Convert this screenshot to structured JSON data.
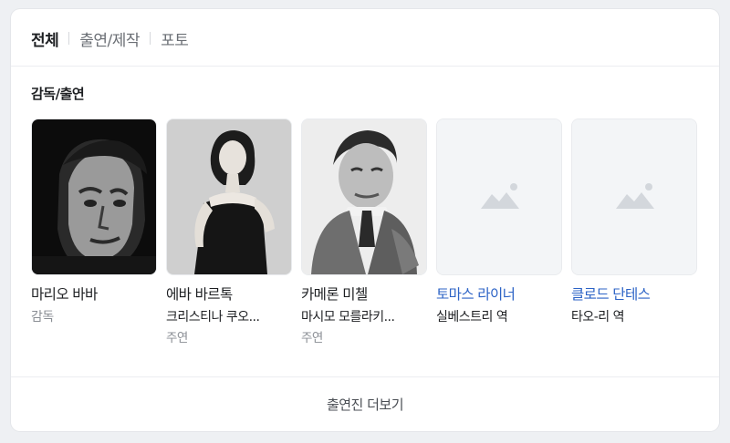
{
  "tabs": [
    {
      "label": "전체",
      "active": true
    },
    {
      "label": "출연/제작",
      "active": false
    },
    {
      "label": "포토",
      "active": false
    }
  ],
  "section_title": "감독/출연",
  "people": [
    {
      "name": "마리오 바바",
      "role": "감독",
      "sub": "",
      "photo": "portrait-photo"
    },
    {
      "name": "에바 바르톡",
      "role": "크리스티나 쿠오...",
      "sub": "주연",
      "photo": "portrait-photo"
    },
    {
      "name": "카메론 미첼",
      "role": "마시모 모를라키...",
      "sub": "주연",
      "photo": "portrait-photo"
    },
    {
      "name": "토마스 라이너",
      "role": "실베스트리 역",
      "sub": "",
      "photo": "image-placeholder-icon"
    },
    {
      "name": "클로드 단테스",
      "role": "타오-리 역",
      "sub": "",
      "photo": "image-placeholder-icon"
    }
  ],
  "more_label": "출연진 더보기",
  "colors": {
    "link": "#2c63c6",
    "text": "#1d1f22",
    "muted": "#8a8e94"
  }
}
